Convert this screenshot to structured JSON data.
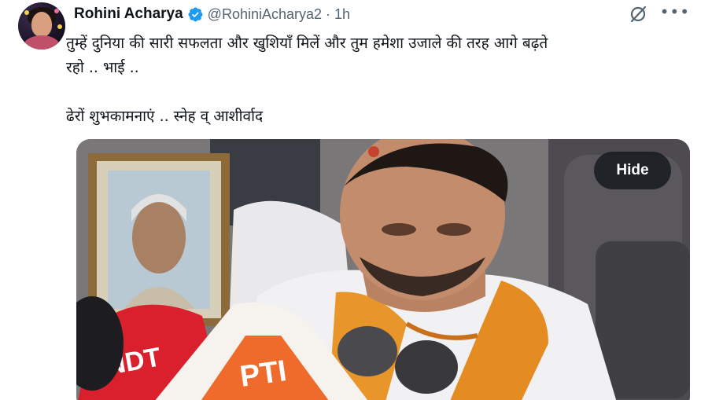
{
  "author": {
    "display_name": "Rohini Acharya",
    "handle": "@RohiniAcharya2",
    "separator": "·",
    "time": "1h",
    "avatar_icon": "avatar-portrait"
  },
  "tweet": {
    "line1": "तुम्हें दुनिया की सारी सफलता और खुशियाँ मिलें और तुम हमेशा  उजाले की तरह आगे बढ़ते",
    "line2": "रहो .. भाई ..",
    "line3": "ढेरों शुभकामनाएं .. स्नेह व् आशीर्वाद"
  },
  "media": {
    "hide_label": "Hide",
    "mic_logo_1": "NDT",
    "mic_logo_2": "PTI"
  },
  "icons": {
    "verified": "verified-badge-icon",
    "grok": "grok-slash-icon",
    "more": "more-dots-icon"
  },
  "colors": {
    "text": "#0f1419",
    "secondary": "#536471",
    "verified": "#1d9bf0",
    "scarf": "#e8962a",
    "mic_red": "#d9202c"
  }
}
